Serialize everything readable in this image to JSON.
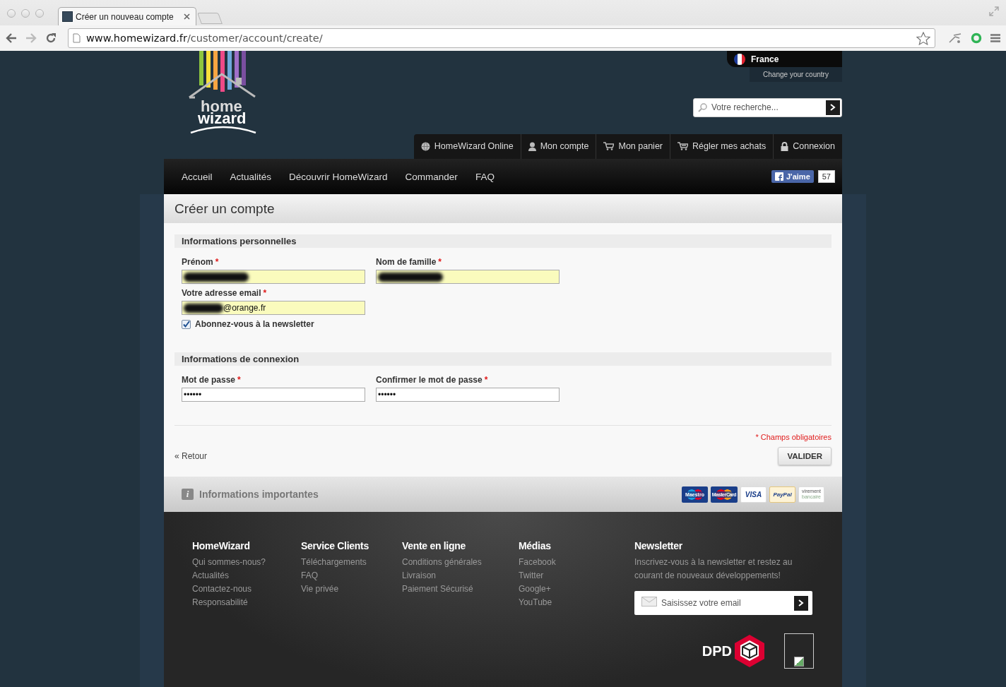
{
  "browser": {
    "tab_title": "Créer un nouveau compte",
    "url_host": "www.homewizard.fr",
    "url_path": "/customer/account/create/"
  },
  "logo": {
    "line1": "home",
    "line2": "wizard"
  },
  "header": {
    "country": "France",
    "change_country": "Change your country",
    "search_placeholder": "Votre recherche...",
    "top_nav": [
      "HomeWizard Online",
      "Mon compte",
      "Mon panier",
      "Régler mes achats",
      "Connexion"
    ],
    "main_nav": [
      "Accueil",
      "Actualités",
      "Découvrir HomeWizard",
      "Commander",
      "FAQ"
    ],
    "like": {
      "label": "J'aime",
      "count": "57"
    }
  },
  "page_title": "Créer un compte",
  "sections": [
    {
      "title": "Informations personnelles",
      "rows": [
        [
          {
            "label": "Prénom",
            "required": true,
            "redacted": true,
            "autofilled": true
          },
          {
            "label": "Nom de famille",
            "required": true,
            "redacted": true,
            "autofilled": true
          }
        ],
        [
          {
            "label": "Votre adresse email",
            "required": true,
            "value": "@orange.fr",
            "redacted": true,
            "autofilled": true
          }
        ]
      ],
      "checkbox": {
        "label": "Abonnez-vous à la newsletter",
        "checked": true
      }
    },
    {
      "title": "Informations de connexion",
      "rows": [
        [
          {
            "label": "Mot de passe",
            "required": true,
            "value": "••••••",
            "autofilled": false
          },
          {
            "label": "Confirmer le mot de passe",
            "required": true,
            "value": "••••••",
            "autofilled": false
          }
        ]
      ]
    }
  ],
  "required_mark": "*",
  "required_note": "* Champs obligatoires",
  "back_link": "« Retour",
  "submit": "VALIDER",
  "info_bar": {
    "icon_glyph": "i",
    "title": "Informations importantes",
    "payments": [
      {
        "kind": "maestro",
        "lines": [
          "Maestro"
        ]
      },
      {
        "kind": "mastercard",
        "lines": [
          "MasterCard"
        ]
      },
      {
        "kind": "visa",
        "lines": [
          "VISA"
        ]
      },
      {
        "kind": "paypal",
        "lines": [
          "PayPal"
        ]
      },
      {
        "kind": "transfer",
        "lines": [
          "virement",
          "bancaire"
        ]
      }
    ]
  },
  "footer": {
    "columns": [
      {
        "title": "HomeWizard",
        "links": [
          "Qui sommes-nous?",
          "Actualités",
          "Contactez-nous",
          "Responsabilité"
        ]
      },
      {
        "title": "Service Clients",
        "links": [
          "Téléchargements",
          "FAQ",
          "Vie privée"
        ]
      },
      {
        "title": "Vente en ligne",
        "links": [
          "Conditions générales",
          "Livraison",
          "Paiement Sécurisé"
        ]
      },
      {
        "title": "Médias",
        "links": [
          "Facebook",
          "Twitter",
          "Google+",
          "YouTube"
        ]
      }
    ],
    "newsletter": {
      "title": "Newsletter",
      "text": "Inscrivez-vous à la newsletter et restez au courant de nouveaux développements!",
      "placeholder": "Saisissez votre email"
    },
    "carrier": "DPD"
  }
}
